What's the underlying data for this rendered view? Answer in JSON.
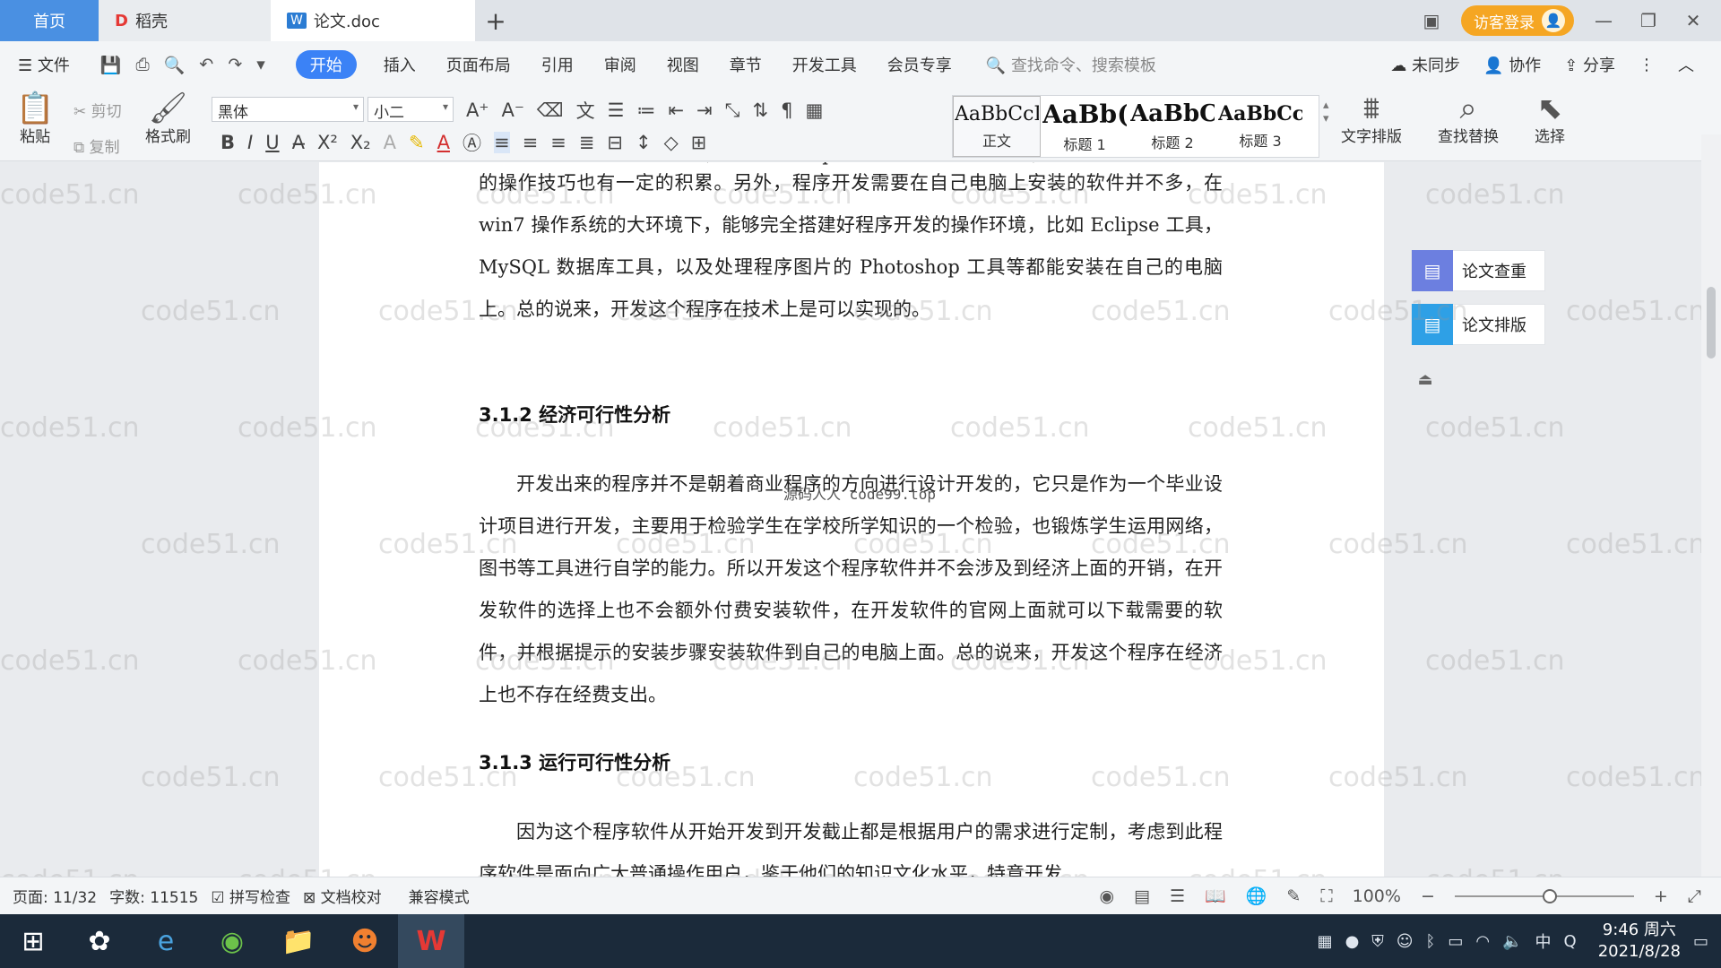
{
  "tabs": {
    "home": "首页",
    "daoke": "稻壳",
    "doc": "论文.doc",
    "plus": "+"
  },
  "login": "访客登录",
  "menu": {
    "file": "文件",
    "items": [
      "开始",
      "插入",
      "页面布局",
      "引用",
      "审阅",
      "视图",
      "章节",
      "开发工具",
      "会员专享"
    ],
    "search_placeholder": "查找命令、搜索模板",
    "sync": "未同步",
    "collab": "协作",
    "share": "分享"
  },
  "ribbon": {
    "paste": "粘贴",
    "cut": "剪切",
    "copy": "复制",
    "format_painter": "格式刷",
    "font": "黑体",
    "size": "小二",
    "styles": [
      {
        "preview": "AaBbCcI",
        "label": "正文"
      },
      {
        "preview": "AaBb(",
        "label": "标题 1"
      },
      {
        "preview": "AaBbC",
        "label": "标题 2"
      },
      {
        "preview": "AaBbCcI",
        "label": "标题 3"
      }
    ],
    "text_layout": "文字排版",
    "find_replace": "查找替换",
    "select": "选择"
  },
  "document": {
    "para_top_partial": "的程序开发方面的设计作品，所以对 Eclipse 工具的使用比较熟练，对于数据库",
    "para1": "的操作技巧也有一定的积累。另外，程序开发需要在自己电脑上安装的软件并不多，在 win7 操作系统的大环境下，能够完全搭建好程序开发的操作环境，比如 Eclipse 工具，MySQL 数据库工具，以及处理程序图片的 Photoshop 工具等都能安装在自己的电脑上。总的说来，开发这个程序在技术上是可以实现的。",
    "heading1": "3.1.2  经济可行性分析",
    "para2": "开发出来的程序并不是朝着商业程序的方向进行设计开发的，它只是作为一个毕业设计项目进行开发，主要用于检验学生在学校所学知识的一个检验，也锻炼学生运用网络，图书等工具进行自学的能力。所以开发这个程序软件并不会涉及到经济上面的开销，在开发软件的选择上也不会额外付费安装软件，在开发软件的官网上面就可以下载需要的软件，并根据提示的安装步骤安装软件到自己的电脑上面。总的说来，开发这个程序在经济上也不存在经费支出。",
    "heading2": "3.1.3  运行可行性分析",
    "para3": "因为这个程序软件从开始开发到开发截止都是根据用户的需求进行定制，考虑到此程序软件是面向广大普通操作用户，鉴于他们的知识文化水平，特意开发",
    "overlay": "源码人人 code99.top",
    "watermark": "code51.cn"
  },
  "side_panel": {
    "check": "论文查重",
    "layout": "论文排版"
  },
  "status": {
    "page": "页面: 11/32",
    "words": "字数: 11515",
    "spell": "拼写检查",
    "proof": "文档校对",
    "compat": "兼容模式",
    "zoom": "100%"
  },
  "taskbar": {
    "time": "9:46 周六",
    "date": "2021/8/28",
    "ime": "中"
  },
  "colors": {
    "accent": "#3b82f6",
    "login": "#f5a623",
    "home_tab": "#4a90e2"
  }
}
